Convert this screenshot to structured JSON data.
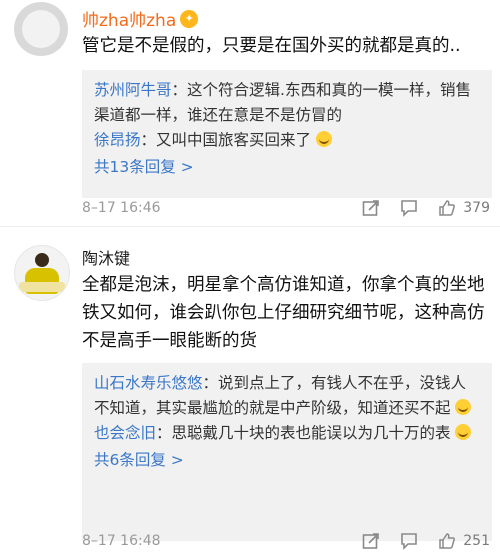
{
  "comments": [
    {
      "user": "帅zha帅zha",
      "has_badge": true,
      "text": "管它是不是假的，只要是在国外买的就都是真的..",
      "replies": [
        {
          "name": "苏州阿牛哥",
          "sep": "：",
          "text": "这个符合逻辑.东西和真的一模一样，销售渠道都一样，谁还在意是不是仿冒的"
        },
        {
          "name": "徐昂扬",
          "sep": "：",
          "text": "又叫中国旅客买回来了"
        }
      ],
      "more_label": "共13条回复 >",
      "time": "8–17 16:46",
      "likes": "379"
    },
    {
      "user": "陶沐键",
      "has_badge": false,
      "text": "全都是泡沫，明星拿个高仿谁知道，你拿个真的坐地铁又如何，谁会趴你包上仔细研究细节呢，这种高仿不是高手一眼能断的货",
      "replies": [
        {
          "name": "山石水寿乐悠悠",
          "sep": "：",
          "text": "说到点上了，有钱人不在乎，没钱人不知道，其实最尴尬的就是中产阶级，知道还买不起"
        },
        {
          "name": "也会念旧",
          "sep": "：",
          "text": "思聪戴几十块的表也能误以为几十万的表"
        }
      ],
      "more_label": "共6条回复 >",
      "time": "8–17 16:48",
      "likes": "251"
    }
  ],
  "icons": {
    "share": "share-icon",
    "comment": "comment-icon",
    "like": "thumbs-up-icon"
  }
}
